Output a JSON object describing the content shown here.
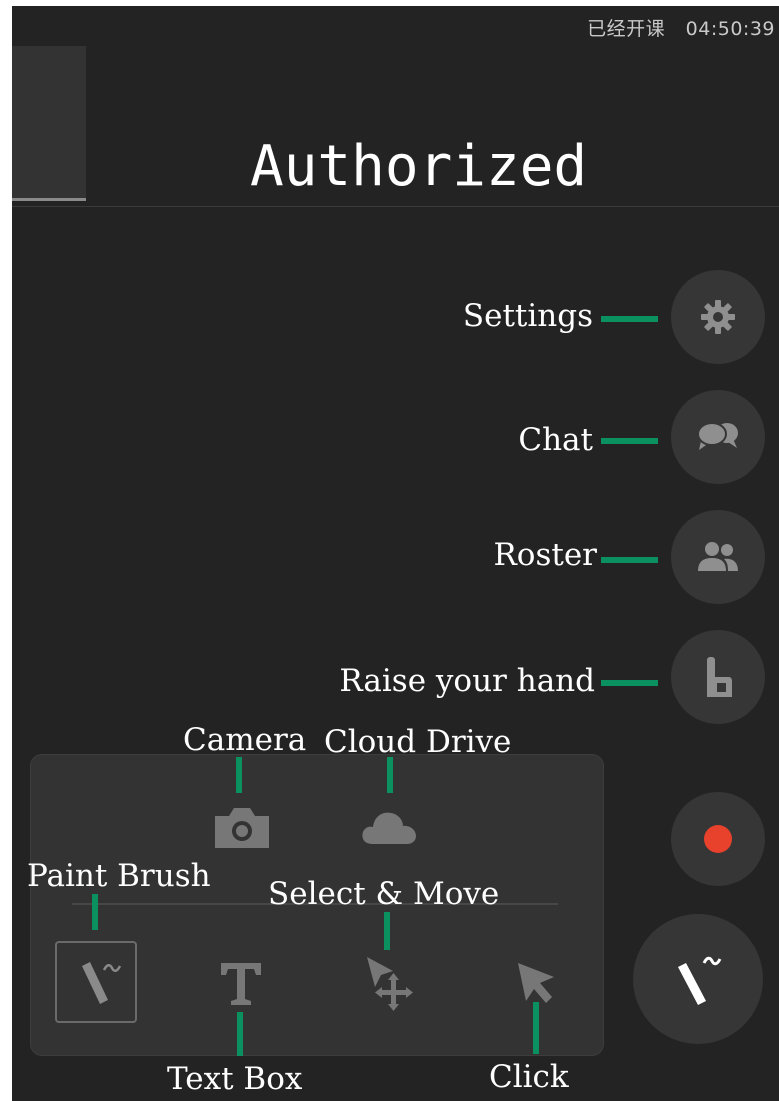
{
  "status_bar": {
    "class_status": "已经开课",
    "timer": "04:50:39"
  },
  "stage": {
    "label": "Authorized"
  },
  "side_buttons": {
    "settings": {
      "icon": "gear-icon",
      "annotation": "Settings"
    },
    "chat": {
      "icon": "chat-bubbles-icon",
      "annotation": "Chat"
    },
    "roster": {
      "icon": "people-icon",
      "annotation": "Roster"
    },
    "raise_hand": {
      "icon": "hand-icon",
      "annotation": "Raise your hand"
    },
    "record": {
      "icon": "record-dot-icon",
      "color": "#e8412c"
    }
  },
  "toolbar": {
    "camera": {
      "icon": "camera-icon",
      "annotation": "Camera"
    },
    "cloud_drive": {
      "icon": "cloud-icon",
      "annotation": "Cloud Drive"
    },
    "paint_brush": {
      "icon": "brush-icon",
      "annotation": "Paint Brush"
    },
    "text_box": {
      "icon": "text-t-icon",
      "annotation": "Text Box"
    },
    "select_move": {
      "icon": "select-move-icon",
      "annotation": "Select & Move"
    },
    "click": {
      "icon": "cursor-arrow-icon",
      "annotation": "Click"
    }
  },
  "fab": {
    "icon": "brush-icon"
  },
  "colors": {
    "annotation_marker": "#0b9060",
    "background": "#232323",
    "record": "#e8412c"
  }
}
